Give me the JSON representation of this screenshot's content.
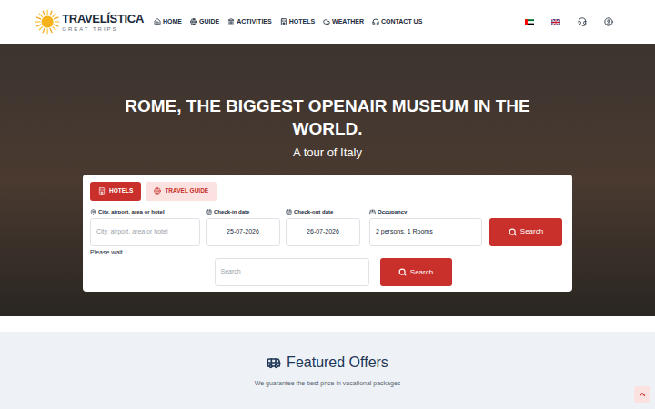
{
  "header": {
    "logo": {
      "name": "TRAVELÍSTICA",
      "tagline": "GREAT TRIPS"
    },
    "nav": [
      "HOME",
      "GUIDE",
      "ACTIVITIES",
      "HOTELS",
      "WEATHER",
      "CONTACT US"
    ]
  },
  "hero": {
    "title": "ROME, THE BIGGEST OPENAIR MUSEUM IN THE WORLD.",
    "subtitle": "A tour of Italy"
  },
  "search_card": {
    "tabs": [
      {
        "label": "HOTELS",
        "selected": true
      },
      {
        "label": "TRAVEL GUIDE",
        "selected": false
      }
    ],
    "fields": [
      {
        "label": "City, airport, area or hotel",
        "value": "",
        "placeholder": "City, airport, area or hotel"
      },
      {
        "label": "Check-in date",
        "value": "25-07-2026",
        "placeholder": ""
      },
      {
        "label": "Check-out date",
        "value": "26-07-2026",
        "placeholder": ""
      },
      {
        "label": "Occupancy",
        "value": "2 persons, 1 Rooms",
        "placeholder": ""
      }
    ],
    "search_button": "Search",
    "status": "Please wait",
    "guide_search": {
      "placeholder": "Search",
      "button": "Search"
    }
  },
  "featured": {
    "title": "Featured Offers",
    "subtitle": "We guarantee the best price in vacational packages"
  }
}
